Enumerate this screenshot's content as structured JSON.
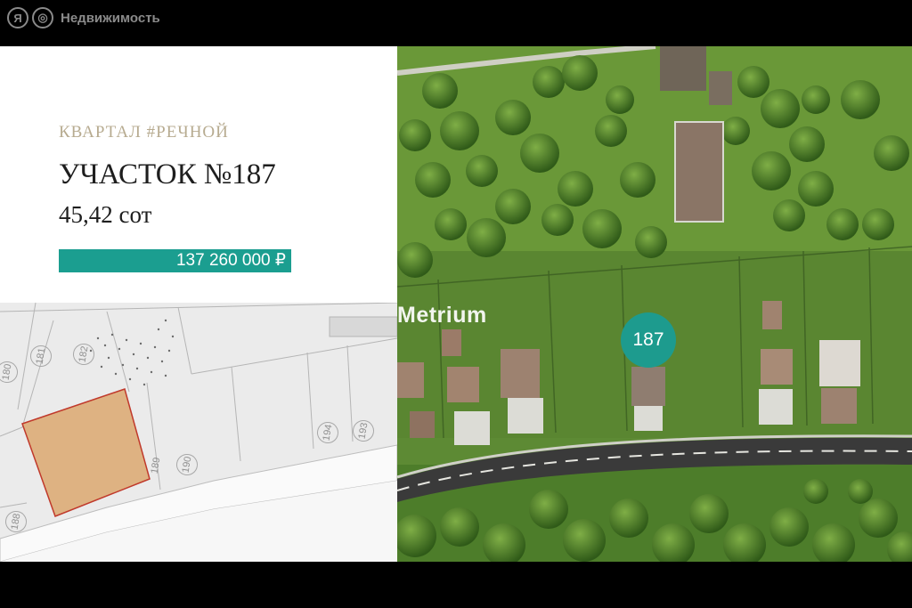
{
  "header": {
    "logo_letter": "Я",
    "logo_glyph": "◎",
    "title": "Недвижимость"
  },
  "listing": {
    "district": "КВАРТАЛ #РЕЧНОЙ",
    "plot_title": "УЧАСТОК №187",
    "area": "45,42 сот",
    "price": "137 260 000 ₽"
  },
  "map": {
    "plot_numbers": [
      "180",
      "181",
      "182",
      "194",
      "193",
      "190",
      "189",
      "188"
    ],
    "highlight_color": "#deb282"
  },
  "photo": {
    "watermark": "Metrium",
    "marker_label": "187",
    "marker_color": "#1d9b8e"
  }
}
